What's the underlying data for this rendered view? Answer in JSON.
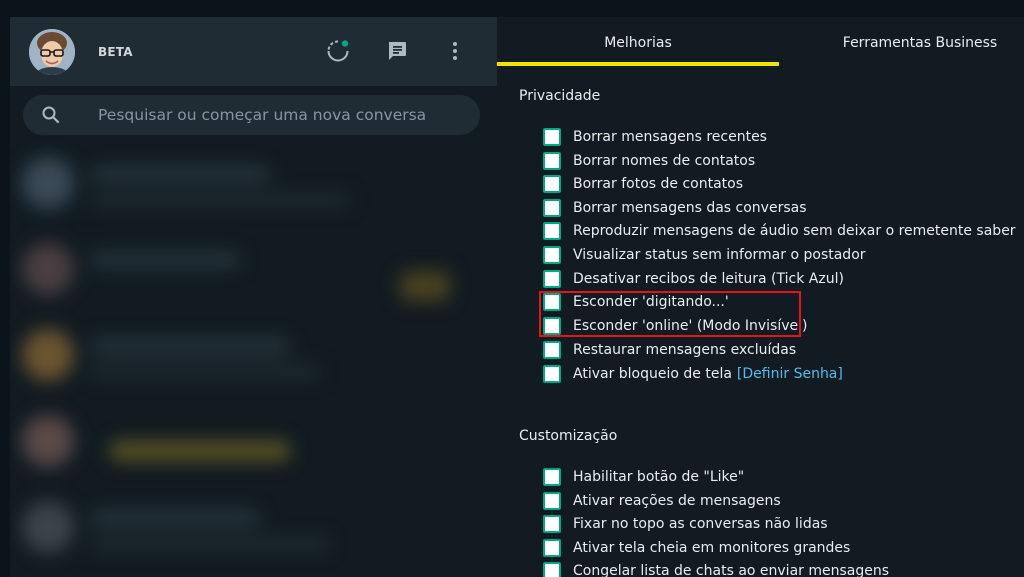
{
  "header": {
    "beta_label": "BETA",
    "icons": [
      "status-icon",
      "new-chat-icon",
      "menu-icon"
    ]
  },
  "search": {
    "placeholder": "Pesquisar ou começar uma nova conversa"
  },
  "tabs": [
    {
      "label": "Melhorias",
      "active": true
    },
    {
      "label": "Ferramentas Business",
      "active": false
    }
  ],
  "sections": {
    "privacy": {
      "title": "Privacidade",
      "options": [
        "Borrar mensagens recentes",
        "Borrar nomes de contatos",
        "Borrar fotos de contatos",
        "Borrar mensagens das conversas",
        "Reproduzir mensagens de áudio sem deixar o remetente saber",
        "Visualizar status sem informar o postador",
        "Desativar recibos de leitura (Tick Azul)",
        "Esconder 'digitando...'",
        "Esconder 'online' (Modo Invisível)",
        "Restaurar mensagens excluídas",
        "Ativar bloqueio de tela"
      ],
      "lock_link": "[Definir Senha]"
    },
    "custom": {
      "title": "Customização",
      "options": [
        "Habilitar botão de \"Like\"",
        "Ativar reações de mensagens",
        "Fixar no topo as conversas não lidas",
        "Ativar tela cheia em monitores grandes",
        "Congelar lista de chats ao enviar mensagens"
      ]
    }
  },
  "colors": {
    "accent": "#00a884",
    "tab_indicator": "#f2e200",
    "highlight": "#e3141b",
    "link": "#53bdeb"
  }
}
